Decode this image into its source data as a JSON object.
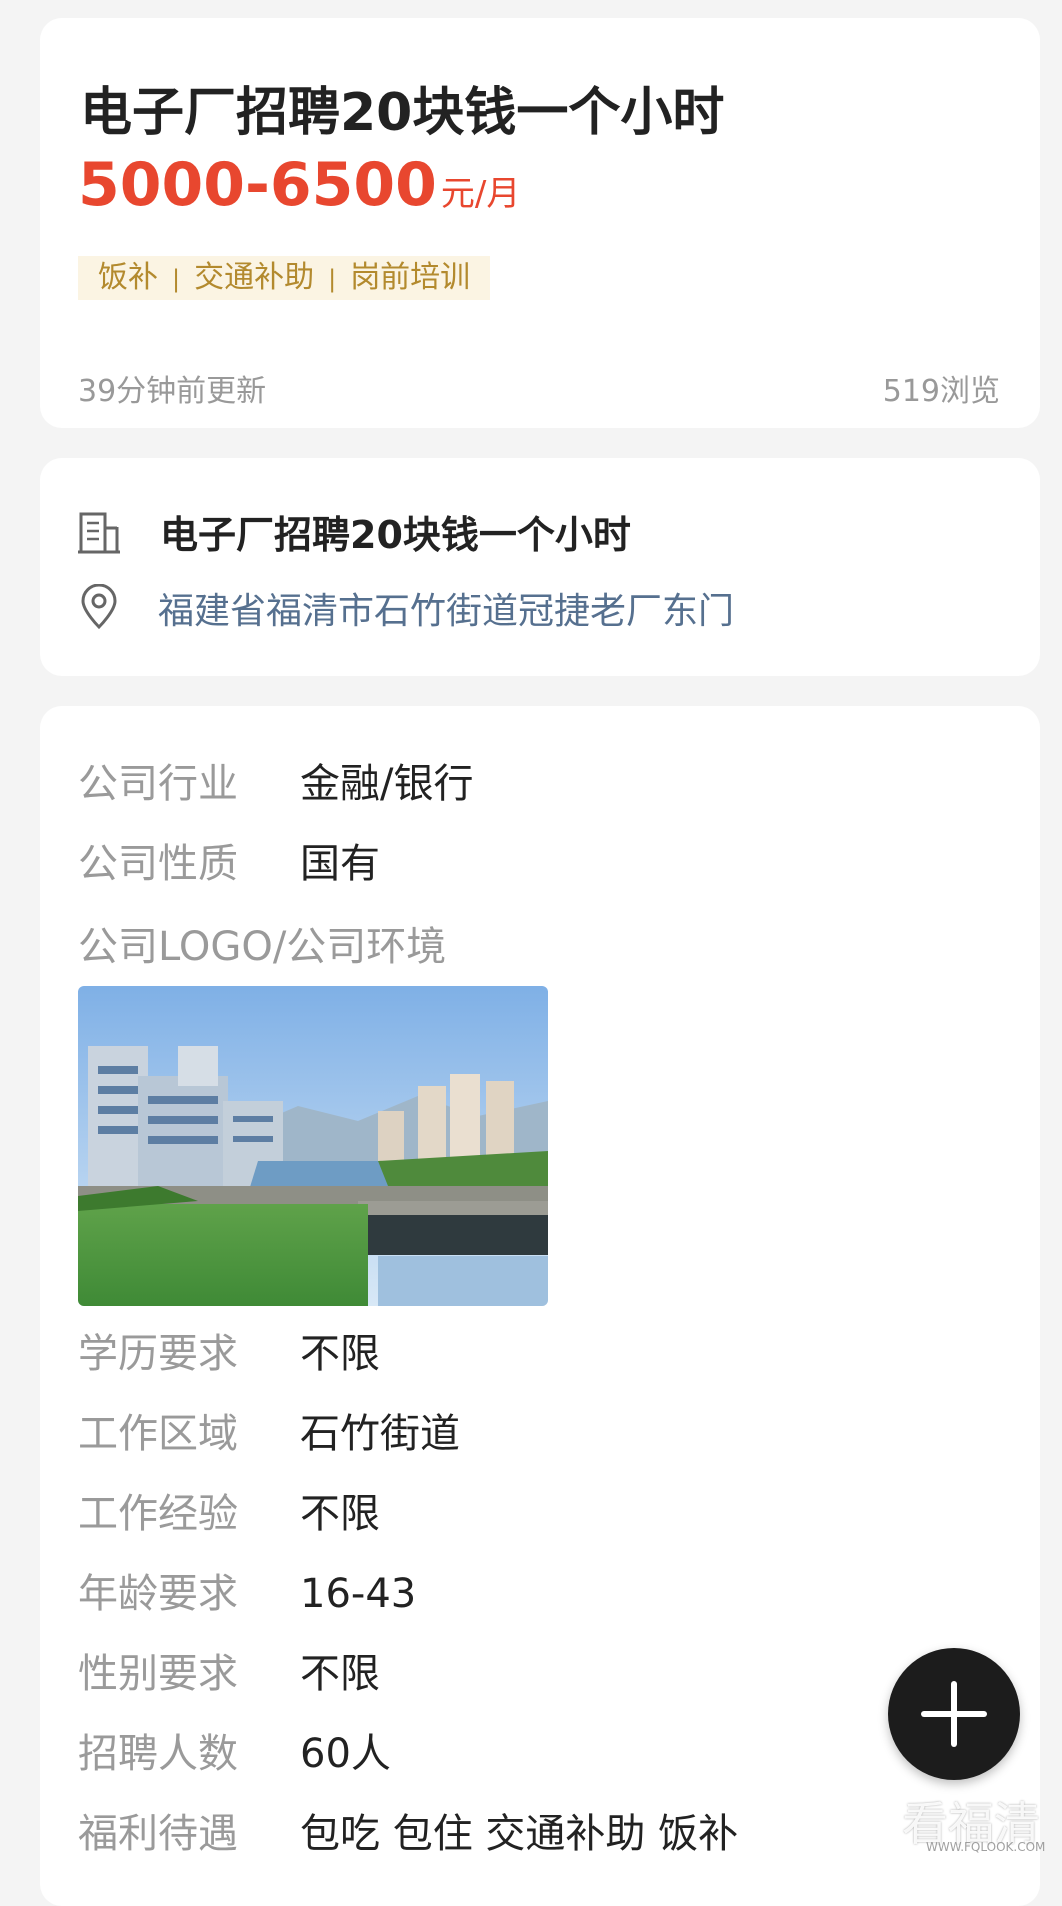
{
  "job": {
    "title": "电子厂招聘20块钱一个小时",
    "salary_range": "5000-6500",
    "salary_unit": "元/月",
    "benefit_tags": [
      "饭补",
      "交通补助",
      "岗前培训"
    ],
    "updated": "39分钟前更新",
    "views": "519浏览"
  },
  "company": {
    "name": "电子厂招聘20块钱一个小时",
    "address": "福建省福清市石竹街道冠捷老厂东门",
    "building_icon": "building-icon",
    "location_icon": "location-pin-icon"
  },
  "details": {
    "industry": {
      "label": "公司行业",
      "value": "金融/银行"
    },
    "nature": {
      "label": "公司性质",
      "value": "国有"
    },
    "photo_label": "公司LOGO/公司环境",
    "education": {
      "label": "学历要求",
      "value": "不限"
    },
    "area": {
      "label": "工作区域",
      "value": "石竹街道"
    },
    "experience": {
      "label": "工作经验",
      "value": "不限"
    },
    "age": {
      "label": "年龄要求",
      "value": "16-43"
    },
    "gender": {
      "label": "性别要求",
      "value": "不限"
    },
    "headcount": {
      "label": "招聘人数",
      "value": "60人"
    },
    "welfare": {
      "label": "福利待遇",
      "value": "包吃 包住 交通补助 饭补"
    }
  },
  "fab": {
    "icon": "plus-icon"
  },
  "watermark": {
    "text": "看福清",
    "sub": "WWW.FQLOOK.COM"
  },
  "colors": {
    "salary": "#e8472f",
    "tag_bg": "#fbf4e3",
    "tag_text": "#b38a2e",
    "address": "#56708f",
    "fab": "#1c1c1c"
  }
}
